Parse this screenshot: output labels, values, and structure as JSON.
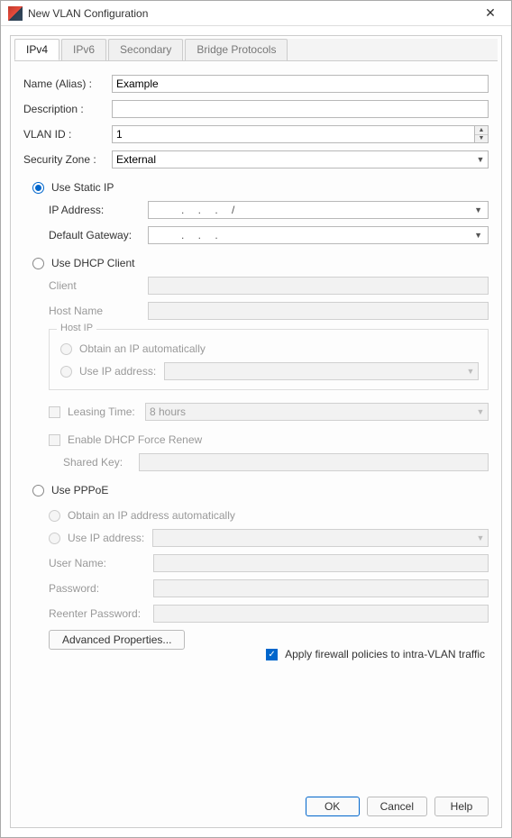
{
  "window": {
    "title": "New VLAN Configuration"
  },
  "tabs": {
    "ipv4": "IPv4",
    "ipv6": "IPv6",
    "secondary": "Secondary",
    "bridge": "Bridge Protocols"
  },
  "fields": {
    "name_label": "Name (Alias) :",
    "name_value": "Example",
    "description_label": "Description :",
    "description_value": "",
    "vlanid_label": "VLAN ID :",
    "vlanid_value": "1",
    "zone_label": "Security Zone :",
    "zone_value": "External"
  },
  "static": {
    "radio_label": "Use Static IP",
    "ip_label": "IP Address:",
    "ip_value": ".   .   .      /",
    "gw_label": "Default Gateway:",
    "gw_value": ".   .   ."
  },
  "dhcp": {
    "radio_label": "Use DHCP Client",
    "client_label": "Client",
    "hostname_label": "Host Name",
    "hostip_legend": "Host IP",
    "obtain_label": "Obtain an IP automatically",
    "useip_label": "Use IP address:",
    "leasing_label": "Leasing Time:",
    "leasing_value": "8 hours",
    "force_label": "Enable DHCP Force Renew",
    "sharedkey_label": "Shared Key:"
  },
  "pppoe": {
    "radio_label": "Use PPPoE",
    "obtain_label": "Obtain an IP address automatically",
    "useip_label": "Use IP address:",
    "username_label": "User Name:",
    "password_label": "Password:",
    "password2_label": "Reenter Password:",
    "adv_btn": "Advanced Properties..."
  },
  "firewall_check_label": "Apply firewall policies to intra-VLAN traffic",
  "buttons": {
    "ok": "OK",
    "cancel": "Cancel",
    "help": "Help"
  }
}
